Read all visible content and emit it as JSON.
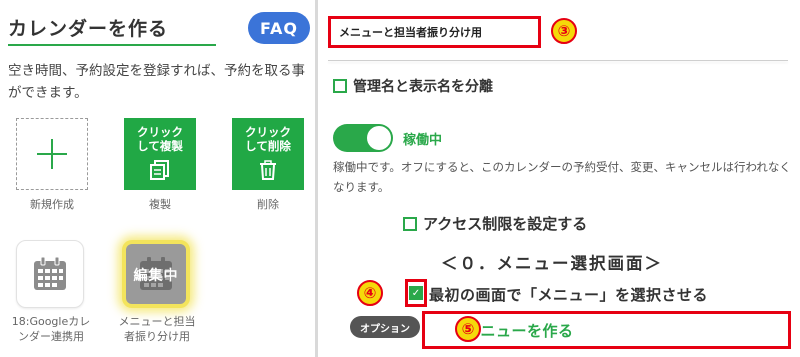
{
  "left": {
    "title": "カレンダーを作る",
    "faq_label": "FAQ",
    "description": "空き時間、予約設定を登録すれば、予約を取る事ができます。",
    "tiles": {
      "new_caption": "新規作成",
      "copy_text_line1": "クリック",
      "copy_text_line2": "して複製",
      "copy_caption": "複製",
      "delete_text_line1": "クリック",
      "delete_text_line2": "して削除",
      "delete_caption": "削除"
    },
    "calendars": {
      "google_caption_line1": "18:Googleカレ",
      "google_caption_line2": "ンダー連携用",
      "edit_overlay": "編集中",
      "edit_caption_line1": "メニューと担当",
      "edit_caption_line2": "者振り分け用"
    }
  },
  "right": {
    "calendar_name_value": "メニューと担当者振り分け用",
    "badge3": "③",
    "separate_names_label": "管理名と表示名を分離",
    "toggle_label": "稼働中",
    "toggle_note": "稼働中です。オフにすると、このカレンダーの予約受付、変更、キャンセルは行われなくなります。",
    "access_label": "アクセス制限を設定する",
    "menu_heading": "＜０．メニュー選択画面＞",
    "badge4": "④",
    "first_screen_label": "最初の画面で「メニュー」を選択させる",
    "option_label": "オプション",
    "badge5": "⑤",
    "make_menu_label": "メニューを作る"
  },
  "colors": {
    "accent_green": "#2aa84a",
    "highlight_red": "#e60012",
    "badge_yellow": "#f5d90a",
    "faq_blue": "#3b74d8"
  }
}
